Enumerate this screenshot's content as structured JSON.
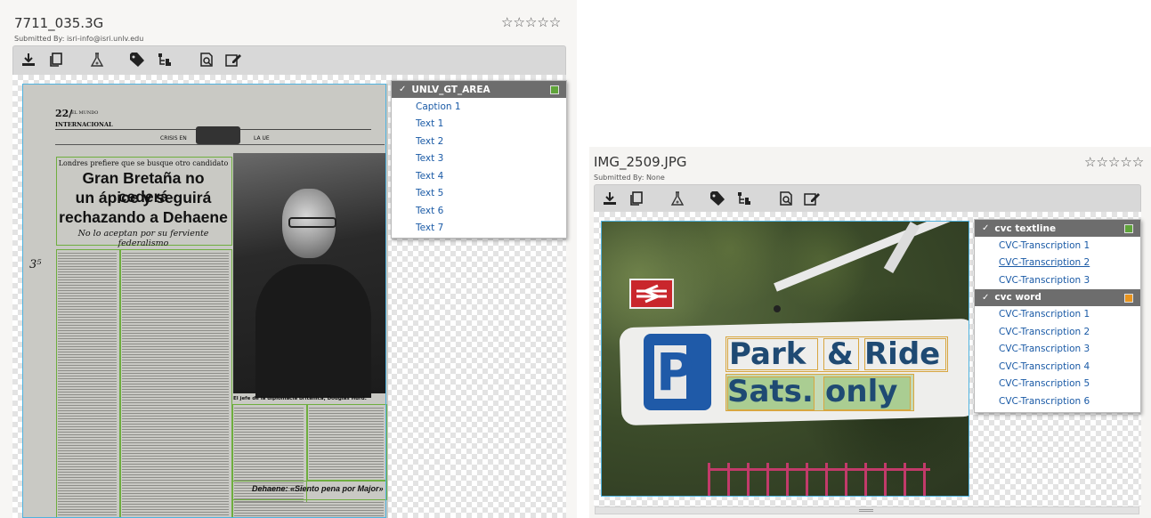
{
  "left_panel": {
    "title": "7711_035.3G",
    "submitted_by": "Submitted By: isri-info@isri.unlv.edu",
    "rating": "☆☆☆☆☆",
    "toolbar_icons": [
      "download-icon",
      "copy-icon",
      "flask-icon",
      "tag-icon",
      "hierarchy-icon",
      "search-document-icon",
      "edit-icon"
    ],
    "dropdown": {
      "header": "UNLV_GT_AREA",
      "header_checkmark": "✓",
      "header_color": "#5fa43a",
      "items": [
        "Caption 1",
        "Text 1",
        "Text 2",
        "Text 3",
        "Text 4",
        "Text 5",
        "Text 6",
        "Text 7"
      ]
    },
    "newspaper": {
      "page_label": "22/",
      "section_label": "EL MUNDO",
      "section": "INTERNACIONAL",
      "crisis_left": "CRISIS EN",
      "crisis_right": "LA UE",
      "kicker": "Londres prefiere que se busque otro candidato",
      "headline_1": "Gran Bretaña no cederá",
      "headline_2": "un ápice y seguirá",
      "headline_3": "rechazando a Dehaene",
      "deck": "No lo aceptan por su ferviente federalismo",
      "photo_caption": "El jefe de la diplomacia británica, Douglas Hurd.",
      "box_title": "Dehaene: «Siento pena por Major»",
      "margin_note": "3⁵"
    }
  },
  "right_panel": {
    "title": "IMG_2509.JPG",
    "submitted_by": "Submitted By: None",
    "rating": "☆☆☆☆☆",
    "toolbar_icons": [
      "download-icon",
      "copy-icon",
      "flask-icon",
      "tag-icon",
      "hierarchy-icon",
      "search-document-icon",
      "edit-icon"
    ],
    "dropdown_groups": [
      {
        "header": "cvc textline",
        "header_checkmark": "✓",
        "header_color": "#5fa43a",
        "items": [
          "CVC-Transcription 1",
          "CVC-Transcription 2",
          "CVC-Transcription 3"
        ]
      },
      {
        "header": "cvc word",
        "header_checkmark": "✓",
        "header_color": "#e8941e",
        "items": [
          "CVC-Transcription 1",
          "CVC-Transcription 2",
          "CVC-Transcription 3",
          "CVC-Transcription 4",
          "CVC-Transcription 5",
          "CVC-Transcription 6"
        ]
      }
    ],
    "sign": {
      "line1_word1": "Park",
      "line1_word2": "&",
      "line1_word3": "Ride",
      "line2_word1": "Sats.",
      "line2_word2": "only",
      "parking_letter": "P"
    }
  }
}
